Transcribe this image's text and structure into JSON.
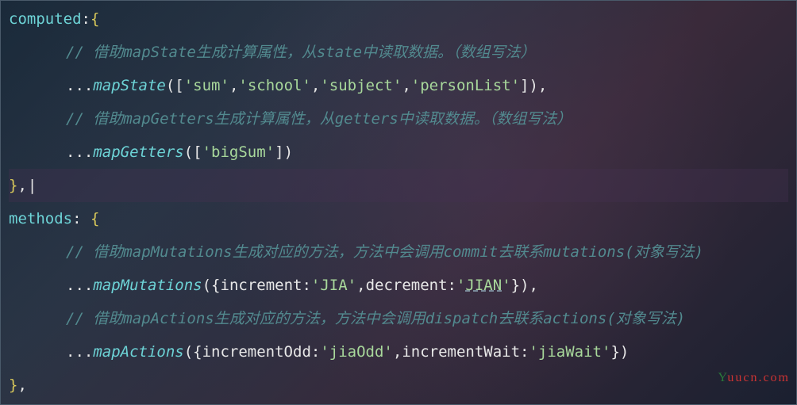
{
  "code": {
    "line1": {
      "property": "computed",
      "colon": ":",
      "brace": "{"
    },
    "line2": {
      "comment": "// 借助mapState生成计算属性，从state中读取数据。（数组写法）"
    },
    "line3": {
      "spread": "...",
      "func": "mapState",
      "args_open": "([",
      "s1": "'sum'",
      "c1": ",",
      "s2": "'school'",
      "c2": ",",
      "s3": "'subject'",
      "c3": ",",
      "s4": "'personList'",
      "args_close": "]),",
      "after": ""
    },
    "line4": {
      "comment": "// 借助mapGetters生成计算属性，从getters中读取数据。（数组写法）"
    },
    "line5": {
      "spread": "...",
      "func": "mapGetters",
      "args_open": "([",
      "s1": "'bigSum'",
      "args_close": "])"
    },
    "line6": {
      "brace": "}",
      "comma": ",",
      "cursor": "|"
    },
    "line7": {
      "property": "methods",
      "colon": ":",
      "space": " ",
      "brace": "{"
    },
    "line8": {
      "comment": "// 借助mapMutations生成对应的方法，方法中会调用commit去联系mutations(对象写法)"
    },
    "line9": {
      "spread": "...",
      "func": "mapMutations",
      "open": "({",
      "k1": "increment",
      "colon1": ":",
      "v1": "'JIA'",
      "c1": ",",
      "k2": "decrement",
      "colon2": ":",
      "v2q": "'",
      "v2": "JIAN",
      "v2q2": "'",
      "close": "}),"
    },
    "line10": {
      "comment": "// 借助mapActions生成对应的方法，方法中会调用dispatch去联系actions(对象写法)"
    },
    "line11": {
      "spread": "...",
      "func": "mapActions",
      "open": "({",
      "k1": "incrementOdd",
      "colon1": ":",
      "v1": "'jiaOdd'",
      "c1": ",",
      "k2": "incrementWait",
      "colon2": ":",
      "v2": "'jiaWait'",
      "close": "})"
    },
    "line12": {
      "brace": "}",
      "comma": ","
    }
  },
  "watermark": {
    "text": "Yuucn.com"
  }
}
